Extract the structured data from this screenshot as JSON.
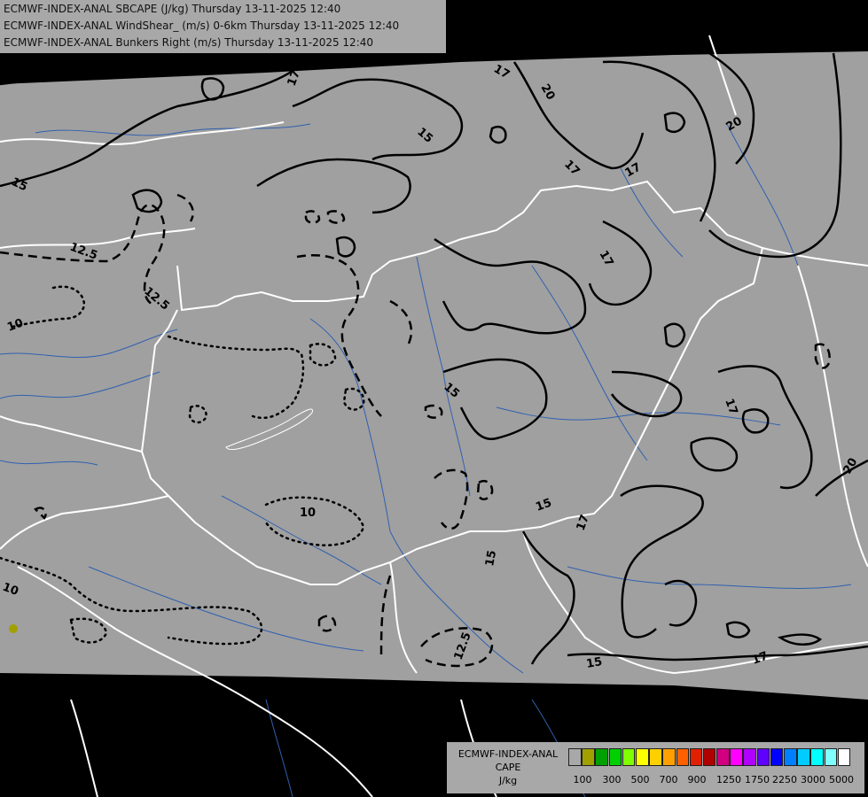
{
  "header": {
    "lines": [
      "ECMWF-INDEX-ANAL SBCAPE (J/kg) Thursday 13-11-2025 12:40",
      "ECMWF-INDEX-ANAL WindShear_ (m/s) 0-6km Thursday 13-11-2025 12:40",
      "ECMWF-INDEX-ANAL Bunkers Right (m/s) Thursday 13-11-2025 12:40"
    ]
  },
  "legend": {
    "name_lines": [
      "ECMWF-INDEX-ANAL",
      "CAPE",
      "J/kg"
    ],
    "colors": [
      "#a8a8a8",
      "#a0a000",
      "#00a000",
      "#00d000",
      "#80ff00",
      "#ffff00",
      "#ffd000",
      "#ffa000",
      "#ff6000",
      "#e02000",
      "#b00000",
      "#d00080",
      "#ff00ff",
      "#b000ff",
      "#6000ff",
      "#0000ff",
      "#0080ff",
      "#00ccff",
      "#00ffff",
      "#80ffff",
      "#ffffff"
    ],
    "tick_labels": [
      "100",
      "300",
      "500",
      "700",
      "900",
      "1250",
      "1750",
      "2250",
      "3000",
      "5000"
    ]
  },
  "map": {
    "colors": {
      "domain": "#a0a0a0",
      "outside": "#000000",
      "borders": "#ffffff",
      "rivers": "#3060b0",
      "isolines": "#000000",
      "cape_spot": "#a0a000"
    },
    "contour_labels": [
      "20",
      "17",
      "17",
      "20",
      "15",
      "15",
      "12.5",
      "12.5",
      "10",
      "15",
      "17",
      "17",
      "17",
      "17",
      "20",
      "10",
      "10",
      "15",
      "17",
      "15",
      "17",
      "12.5",
      "15",
      "20",
      "17"
    ]
  }
}
